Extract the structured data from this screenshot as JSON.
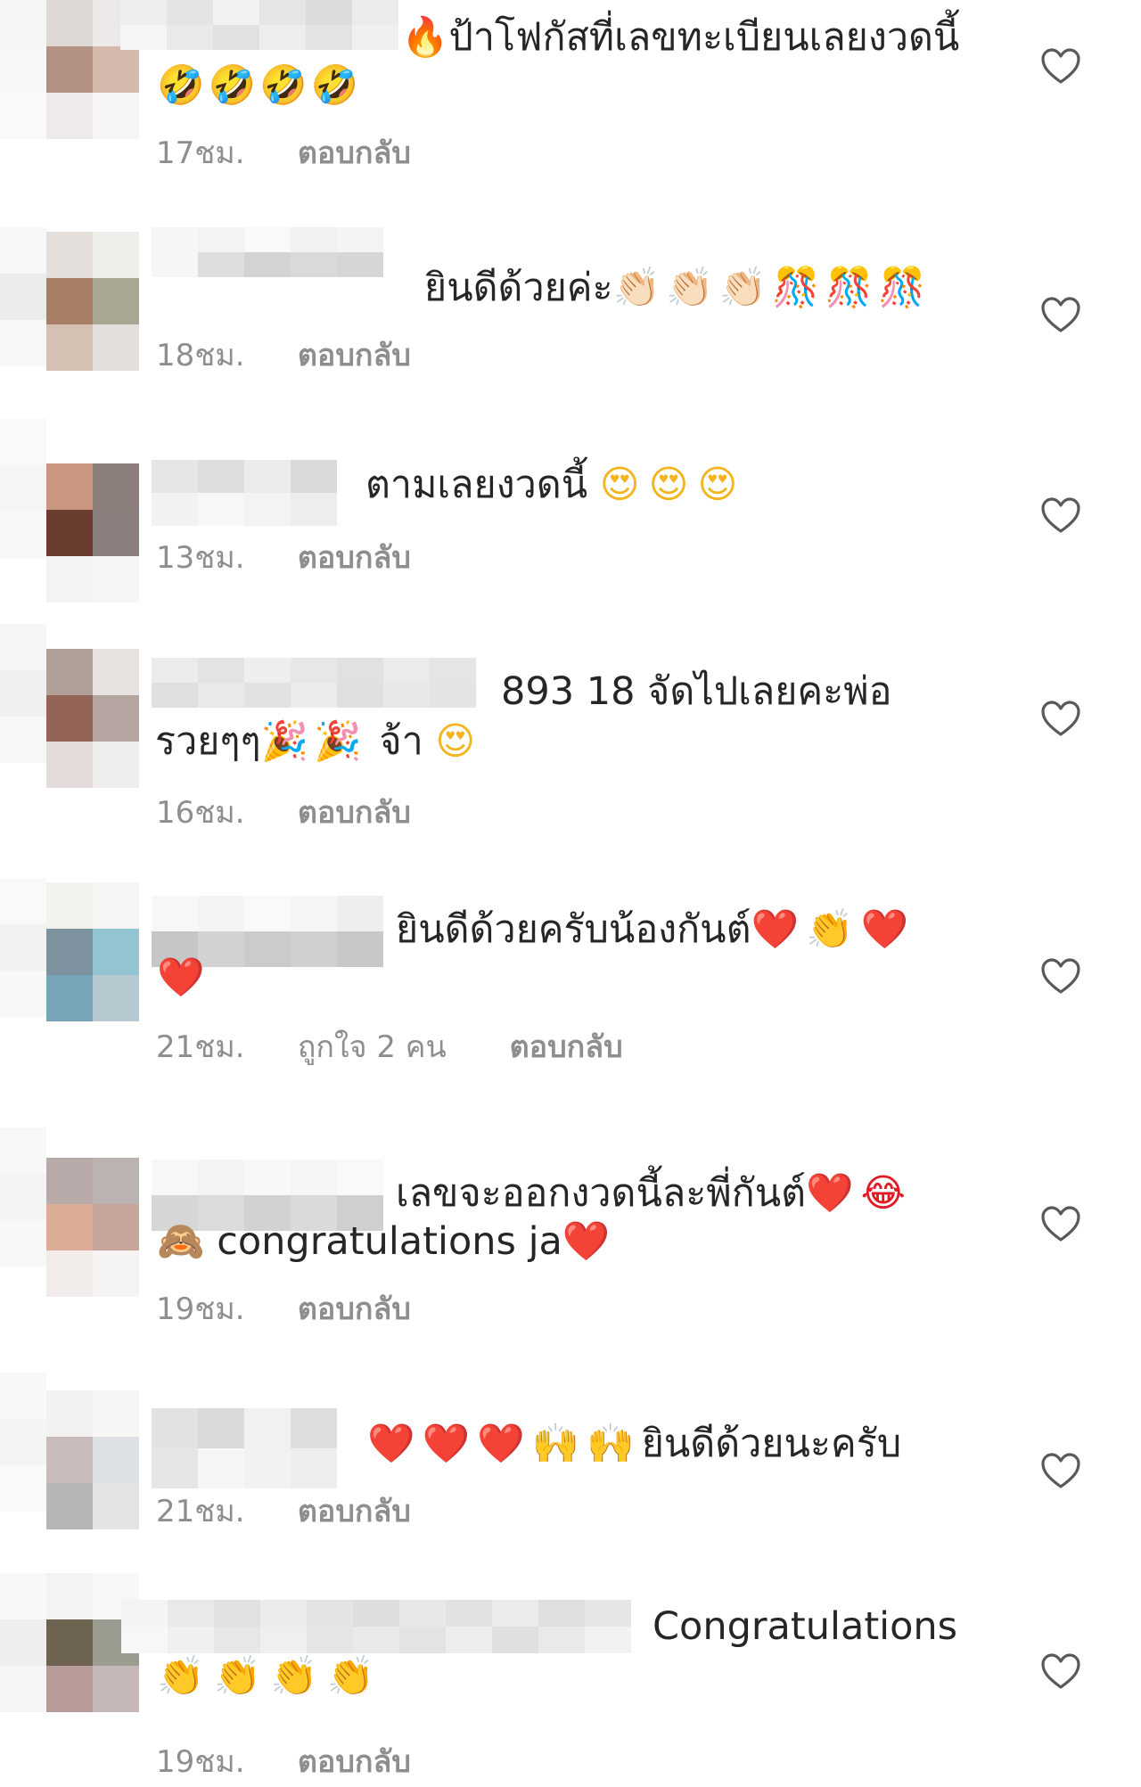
{
  "comments": [
    {
      "line1_emoji": "🔥",
      "line1": "ป้าโฟกัสที่เลขทะเบียนเลยงวดนี้",
      "line2_emoji": "🤣🤣🤣🤣",
      "time": "17ชม.",
      "reply": "ตอบกลับ"
    },
    {
      "line1": "ยินดีด้วยค่ะ",
      "line1_emoji": "👏🏻👏🏻👏🏻🎊🎊🎊",
      "time": "18ชม.",
      "reply": "ตอบกลับ"
    },
    {
      "line1": "ตามเลยงวดนี้",
      "line1_emoji": "😍😍😍",
      "time": "13ชม.",
      "reply": "ตอบกลับ"
    },
    {
      "line1": "893 18 จัดไปเลยคะพ่อ",
      "line2": "รวยๆๆ",
      "line2_emoji": "🎉🎉",
      "line2_tail": "จ้า",
      "line2_tail_emoji": "😍",
      "time": "16ชม.",
      "reply": "ตอบกลับ"
    },
    {
      "line1": "ยินดีด้วยครับน้องกันต์",
      "line1_emoji": "❤️👏❤️",
      "line2_emoji": "❤️",
      "time": "21ชม.",
      "likes": "ถูกใจ 2 คน",
      "reply": "ตอบกลับ"
    },
    {
      "line1": "เลขจะออกงวดนี้ละพี่กันต์",
      "line1_emoji": "❤️😂",
      "line2_emoji": "🙈",
      "line2": "congratulations ja",
      "line2_tail_emoji": "❤️",
      "time": "19ชม.",
      "reply": "ตอบกลับ"
    },
    {
      "line1_emoji": "❤️❤️❤️🙌🙌",
      "line1": "ยินดีด้วยนะครับ",
      "time": "21ชม.",
      "reply": "ตอบกลับ"
    },
    {
      "line1": "Congratulations",
      "line2_emoji": "👏👏👏👏",
      "time": "19ชม.",
      "reply": "ตอบกลับ"
    }
  ]
}
